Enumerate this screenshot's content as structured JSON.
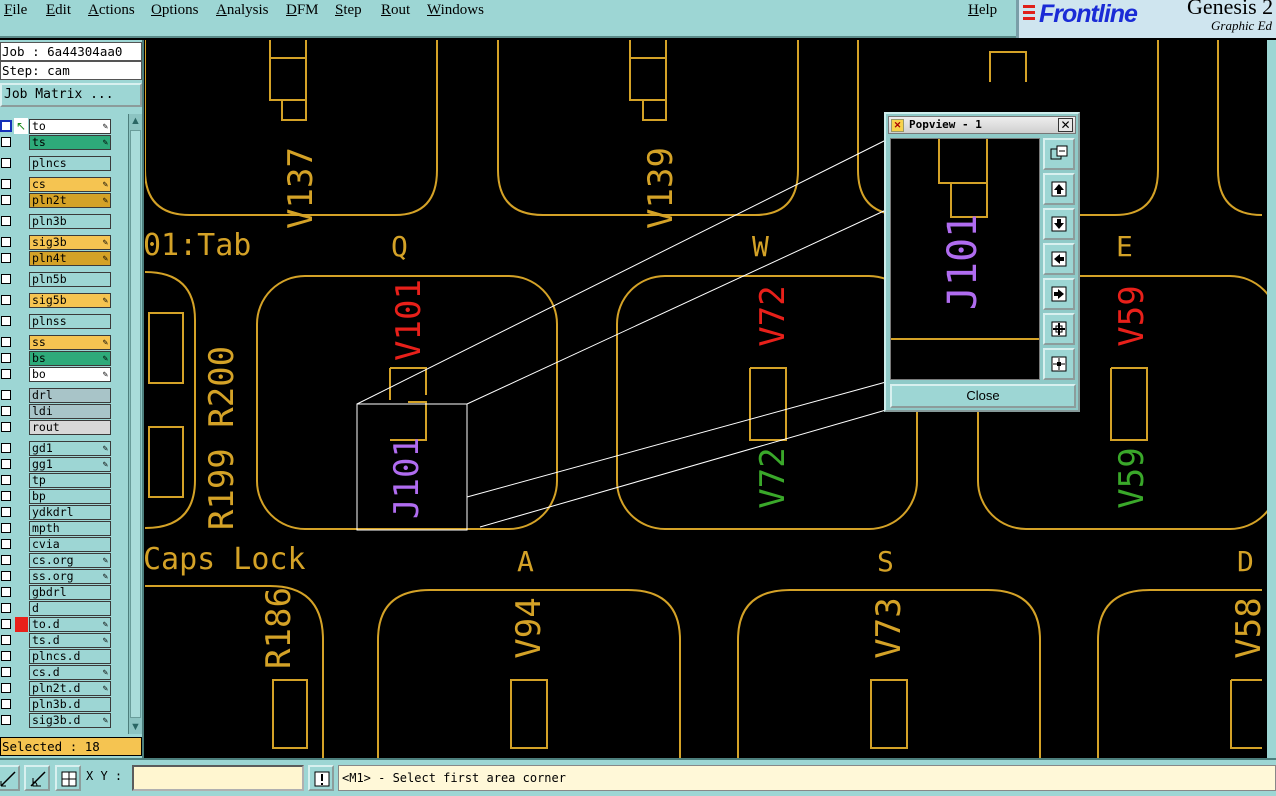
{
  "menu": {
    "items": [
      "File",
      "Edit",
      "Actions",
      "Options",
      "Analysis",
      "DFM",
      "Step",
      "Rout",
      "Windows"
    ],
    "help": "Help"
  },
  "brand": {
    "logo": "Frontline",
    "product": "Genesis 2",
    "subtitle": "Graphic Ed"
  },
  "job": {
    "job_line": "Job : 6a44304aa0",
    "step_line": "Step: cam",
    "matrix_button": "Job Matrix ..."
  },
  "layers": [
    {
      "name": "to",
      "color": "#ffffff",
      "swatch": "arrow",
      "edit": true,
      "checked": true
    },
    {
      "name": "ts",
      "color": "#2eaa7a",
      "swatch": "none",
      "edit": true,
      "checked": false
    },
    {
      "name": "plncs",
      "color": "#9dd6d4",
      "swatch": "none",
      "edit": false,
      "checked": false
    },
    {
      "name": "cs",
      "color": "#f5c451",
      "swatch": "none",
      "edit": true,
      "checked": false
    },
    {
      "name": "pln2t",
      "color": "#d4a227",
      "swatch": "none",
      "edit": true,
      "checked": false
    },
    {
      "name": "pln3b",
      "color": "#9dd6d4",
      "swatch": "none",
      "edit": false,
      "checked": false
    },
    {
      "name": "sig3b",
      "color": "#f5c451",
      "swatch": "none",
      "edit": true,
      "checked": false
    },
    {
      "name": "pln4t",
      "color": "#d4a227",
      "swatch": "none",
      "edit": true,
      "checked": false
    },
    {
      "name": "pln5b",
      "color": "#9dd6d4",
      "swatch": "none",
      "edit": false,
      "checked": false
    },
    {
      "name": "sig5b",
      "color": "#f5c451",
      "swatch": "none",
      "edit": true,
      "checked": false
    },
    {
      "name": "plnss",
      "color": "#9dd6d4",
      "swatch": "none",
      "edit": false,
      "checked": false
    },
    {
      "name": "ss",
      "color": "#f5c451",
      "swatch": "none",
      "edit": true,
      "checked": false
    },
    {
      "name": "bs",
      "color": "#2eaa7a",
      "swatch": "none",
      "edit": true,
      "checked": false
    },
    {
      "name": "bo",
      "color": "#ffffff",
      "swatch": "none",
      "edit": true,
      "checked": false
    },
    {
      "name": "drl",
      "color": "#a8c4c8",
      "swatch": "none",
      "edit": false,
      "checked": false
    },
    {
      "name": "ldi",
      "color": "#a8c4c8",
      "swatch": "none",
      "edit": false,
      "checked": false
    },
    {
      "name": "rout",
      "color": "#d8d8d8",
      "swatch": "none",
      "edit": false,
      "checked": false
    },
    {
      "name": "gd1",
      "color": "#9dd6d4",
      "swatch": "none",
      "edit": true,
      "checked": false
    },
    {
      "name": "gg1",
      "color": "#9dd6d4",
      "swatch": "none",
      "edit": true,
      "checked": false
    },
    {
      "name": "tp",
      "color": "#9dd6d4",
      "swatch": "none",
      "edit": false,
      "checked": false
    },
    {
      "name": "bp",
      "color": "#9dd6d4",
      "swatch": "none",
      "edit": false,
      "checked": false
    },
    {
      "name": "ydkdrl",
      "color": "#9dd6d4",
      "swatch": "none",
      "edit": false,
      "checked": false
    },
    {
      "name": "mpth",
      "color": "#9dd6d4",
      "swatch": "none",
      "edit": false,
      "checked": false
    },
    {
      "name": "cvia",
      "color": "#9dd6d4",
      "swatch": "none",
      "edit": false,
      "checked": false
    },
    {
      "name": "cs.org",
      "color": "#9dd6d4",
      "swatch": "none",
      "edit": true,
      "checked": false
    },
    {
      "name": "ss.org",
      "color": "#9dd6d4",
      "swatch": "none",
      "edit": true,
      "checked": false
    },
    {
      "name": "gbdrl",
      "color": "#9dd6d4",
      "swatch": "none",
      "edit": false,
      "checked": false
    },
    {
      "name": "d",
      "color": "#9dd6d4",
      "swatch": "none",
      "edit": false,
      "checked": false
    },
    {
      "name": "to.d",
      "color": "#9dd6d4",
      "swatch": "red",
      "edit": true,
      "checked": false
    },
    {
      "name": "ts.d",
      "color": "#9dd6d4",
      "swatch": "none",
      "edit": true,
      "checked": false
    },
    {
      "name": "plncs.d",
      "color": "#9dd6d4",
      "swatch": "none",
      "edit": false,
      "checked": false
    },
    {
      "name": "cs.d",
      "color": "#9dd6d4",
      "swatch": "none",
      "edit": true,
      "checked": false
    },
    {
      "name": "pln2t.d",
      "color": "#9dd6d4",
      "swatch": "none",
      "edit": true,
      "checked": false
    },
    {
      "name": "pln3b.d",
      "color": "#9dd6d4",
      "swatch": "none",
      "edit": false,
      "checked": false
    },
    {
      "name": "sig3b.d",
      "color": "#9dd6d4",
      "swatch": "none",
      "edit": true,
      "checked": false
    }
  ],
  "selected": "Selected : 18",
  "canvas": {
    "labels": {
      "tab": "01:Tab",
      "caps_lock": "Caps Lock",
      "resistors": "R199 R200",
      "r186": "R186",
      "key_q": "Q",
      "key_w": "W",
      "key_e": "E",
      "key_a": "A",
      "key_s": "S",
      "key_d": "D",
      "v137": "V137",
      "v139": "V139",
      "v101": "V101",
      "v72_red": "V72",
      "v59_red": "V59",
      "j101": "J101",
      "v72_green": "V72",
      "v59_green": "V59",
      "v94": "V94",
      "v73": "V73",
      "v58": "V58"
    },
    "colors": {
      "outline": "#d4a227",
      "red_text": "#e8201a",
      "green_text": "#3aa82a",
      "purple_text": "#b06cf0"
    }
  },
  "popview": {
    "title": "Popview - 1",
    "label": "J101",
    "close": "Close",
    "tools": [
      "zoom-fit-icon",
      "pan-up-icon",
      "pan-down-icon",
      "pan-left-icon",
      "pan-right-icon",
      "zoom-in-icon",
      "zoom-out-icon"
    ]
  },
  "status": {
    "xy_label": "X Y :",
    "xy_value": "",
    "message": "<M1> - Select first area corner"
  }
}
